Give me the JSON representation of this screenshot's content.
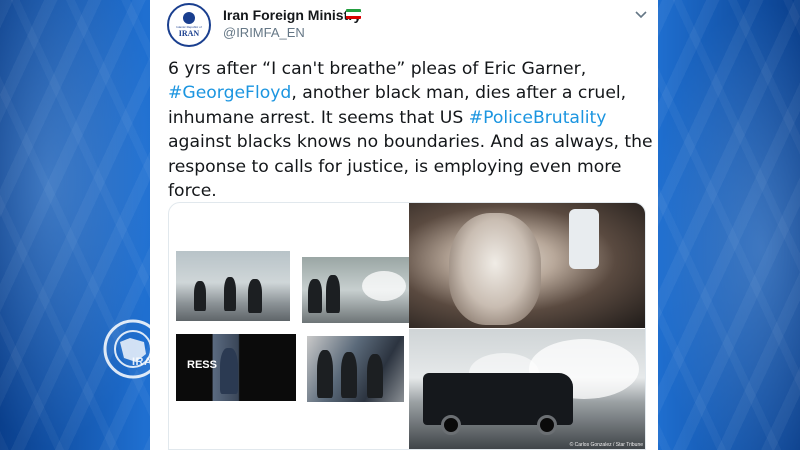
{
  "tweet": {
    "display_name": "Iran Foreign Ministry",
    "handle": "@IRIMFA_EN",
    "avatar_text": "IRAN",
    "avatar_subtext": "Islamic Republic of",
    "text_part1": "6 yrs after “I can't breathe” pleas of Eric Garner, ",
    "hashtag1": "#GeorgeFloyd",
    "text_part2": ", another black man, dies after a cruel, inhumane arrest. It seems that US ",
    "hashtag2": "#PoliceBrutality",
    "text_part3": " against blacks knows no boundaries. And as always, the response to calls for justice, is employing even more force.",
    "flag_colors": [
      "#239f40",
      "#ffffff",
      "#da0000"
    ],
    "hashtag_color": "#1b95e0"
  },
  "media": {
    "photo_credit": "© Carlos Gonzalez / Star Tribune",
    "press_overlay_text": "RESS"
  },
  "watermark": {
    "label": "IRAN"
  },
  "icons": {
    "menu": "chevron-down-icon",
    "verified_flag": "iran-flag-icon",
    "watermark": "iran-press-globe-icon"
  }
}
